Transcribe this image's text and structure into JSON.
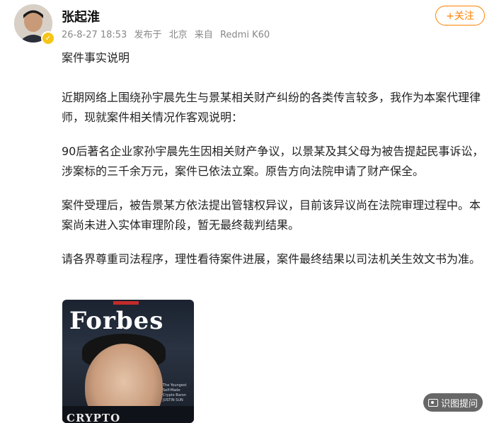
{
  "post": {
    "username": "张起淮",
    "date": "26-8-27 18:53",
    "location_prefix": "发布于",
    "location": "北京",
    "device_prefix": "来自",
    "device": "Redmi K60",
    "follow_label": "+关注",
    "paragraphs": [
      "案件事实说明",
      "近期网络上围绕孙宇晨先生与景某相关财产纠纷的各类传言较多，我作为本案代理律师，现就案件相关情况作客观说明：",
      "90后著名企业家孙宇晨先生因相关财产争议，以景某及其父母为被告提起民事诉讼，涉案标的三千余万元，案件已依法立案。原告方向法院申请了财产保全。",
      "案件受理后，被告景某方依法提出管辖权异议，目前该异议尚在法院审理过程中。本案尚未进入实体审理阶段，暂无最终裁判结果。",
      "请各界尊重司法程序，理性看待案件进展，案件最终结果以司法机关生效文书为准。"
    ]
  },
  "cover": {
    "logo": "Forbes",
    "bottom_text": "CRYPTO",
    "side_text": "The Youngest Self-Made Crypto Baron JUSTIN SUN"
  },
  "fab": {
    "label": "识图提问",
    "icon": "image-question-icon"
  },
  "colors": {
    "accent": "#ff8200",
    "verified": "#f5c518"
  }
}
